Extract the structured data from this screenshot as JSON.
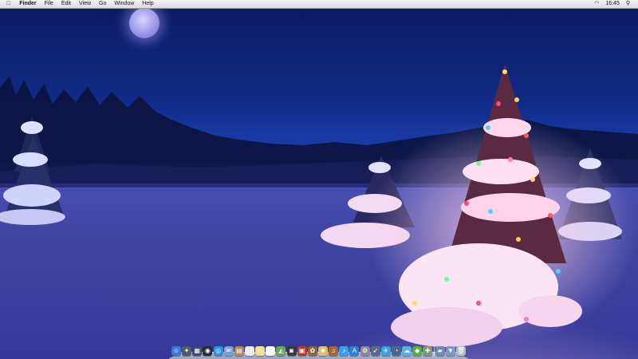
{
  "menubar": {
    "apple_icon": "apple-logo-icon",
    "app_name": "Finder",
    "menus": [
      "File",
      "Edit",
      "View",
      "Go",
      "Window",
      "Help"
    ],
    "clock": "16:45",
    "status_icons": [
      "wifi-icon",
      "spotlight-icon"
    ]
  },
  "desktop": {
    "wallpaper": "snowy night forest with lit Christmas tree",
    "accent_colors": {
      "sky": "#102a86",
      "snow": "#4a52b8",
      "glow": "#ffc8e6"
    }
  },
  "dock": {
    "apps": [
      {
        "icon": "finder-icon",
        "glyph": "☺",
        "color": "#3a78d8"
      },
      {
        "icon": "launchpad-icon",
        "glyph": "✦",
        "color": "#555a66"
      },
      {
        "icon": "mission-control-icon",
        "glyph": "▦",
        "color": "#3c4a6e"
      },
      {
        "icon": "dashboard-icon",
        "glyph": "◉",
        "color": "#2b2b2b"
      },
      {
        "icon": "safari-icon",
        "glyph": "◎",
        "color": "#2f8ee0"
      },
      {
        "icon": "mail-icon",
        "glyph": "✉",
        "color": "#7aa0d8"
      },
      {
        "icon": "contacts-icon",
        "glyph": "▤",
        "color": "#b08a5a"
      },
      {
        "icon": "calendar-icon",
        "glyph": "17",
        "color": "#e9e9e9"
      },
      {
        "icon": "notes-icon",
        "glyph": "▭",
        "color": "#f0e08a"
      },
      {
        "icon": "reminders-icon",
        "glyph": "☰",
        "color": "#f4f4f4"
      },
      {
        "icon": "maps-icon",
        "glyph": "◭",
        "color": "#6aa85a"
      },
      {
        "icon": "photo-booth-icon",
        "glyph": "◙",
        "color": "#3a3a3a"
      },
      {
        "icon": "facetime-icon",
        "glyph": "▣",
        "color": "#c03a2a"
      },
      {
        "icon": "photos-icon",
        "glyph": "✿",
        "color": "#8a6a3a"
      },
      {
        "icon": "iphoto-icon",
        "glyph": "❀",
        "color": "#d8c070"
      },
      {
        "icon": "garageband-icon",
        "glyph": "♫",
        "color": "#9a6a3a"
      },
      {
        "icon": "itunes-icon",
        "glyph": "♪",
        "color": "#3aa0e8"
      },
      {
        "icon": "app-store-icon",
        "glyph": "A",
        "color": "#2a80d8"
      },
      {
        "icon": "system-preferences-icon",
        "glyph": "⚙",
        "color": "#8a8a90"
      },
      {
        "icon": "rocket-icon",
        "glyph": "➶",
        "color": "#5a6a88"
      },
      {
        "icon": "bird-icon",
        "glyph": "✈",
        "color": "#3aa0e0"
      },
      {
        "icon": "time-machine-icon",
        "glyph": "◔",
        "color": "#4a6a8a"
      },
      {
        "icon": "weather-icon",
        "glyph": "☁",
        "color": "#5ab0e8"
      },
      {
        "icon": "evernote-icon",
        "glyph": "◆",
        "color": "#5aaa4a"
      },
      {
        "icon": "utility-icon",
        "glyph": "✚",
        "color": "#7a9a7a"
      }
    ],
    "stacks": [
      {
        "icon": "applications-folder-icon",
        "glyph": "▰",
        "color": "#6a8ab8"
      },
      {
        "icon": "downloads-folder-icon",
        "glyph": "▼",
        "color": "#7a98c8"
      },
      {
        "icon": "trash-icon",
        "glyph": "🗑",
        "color": "#b8bcc4"
      }
    ]
  }
}
